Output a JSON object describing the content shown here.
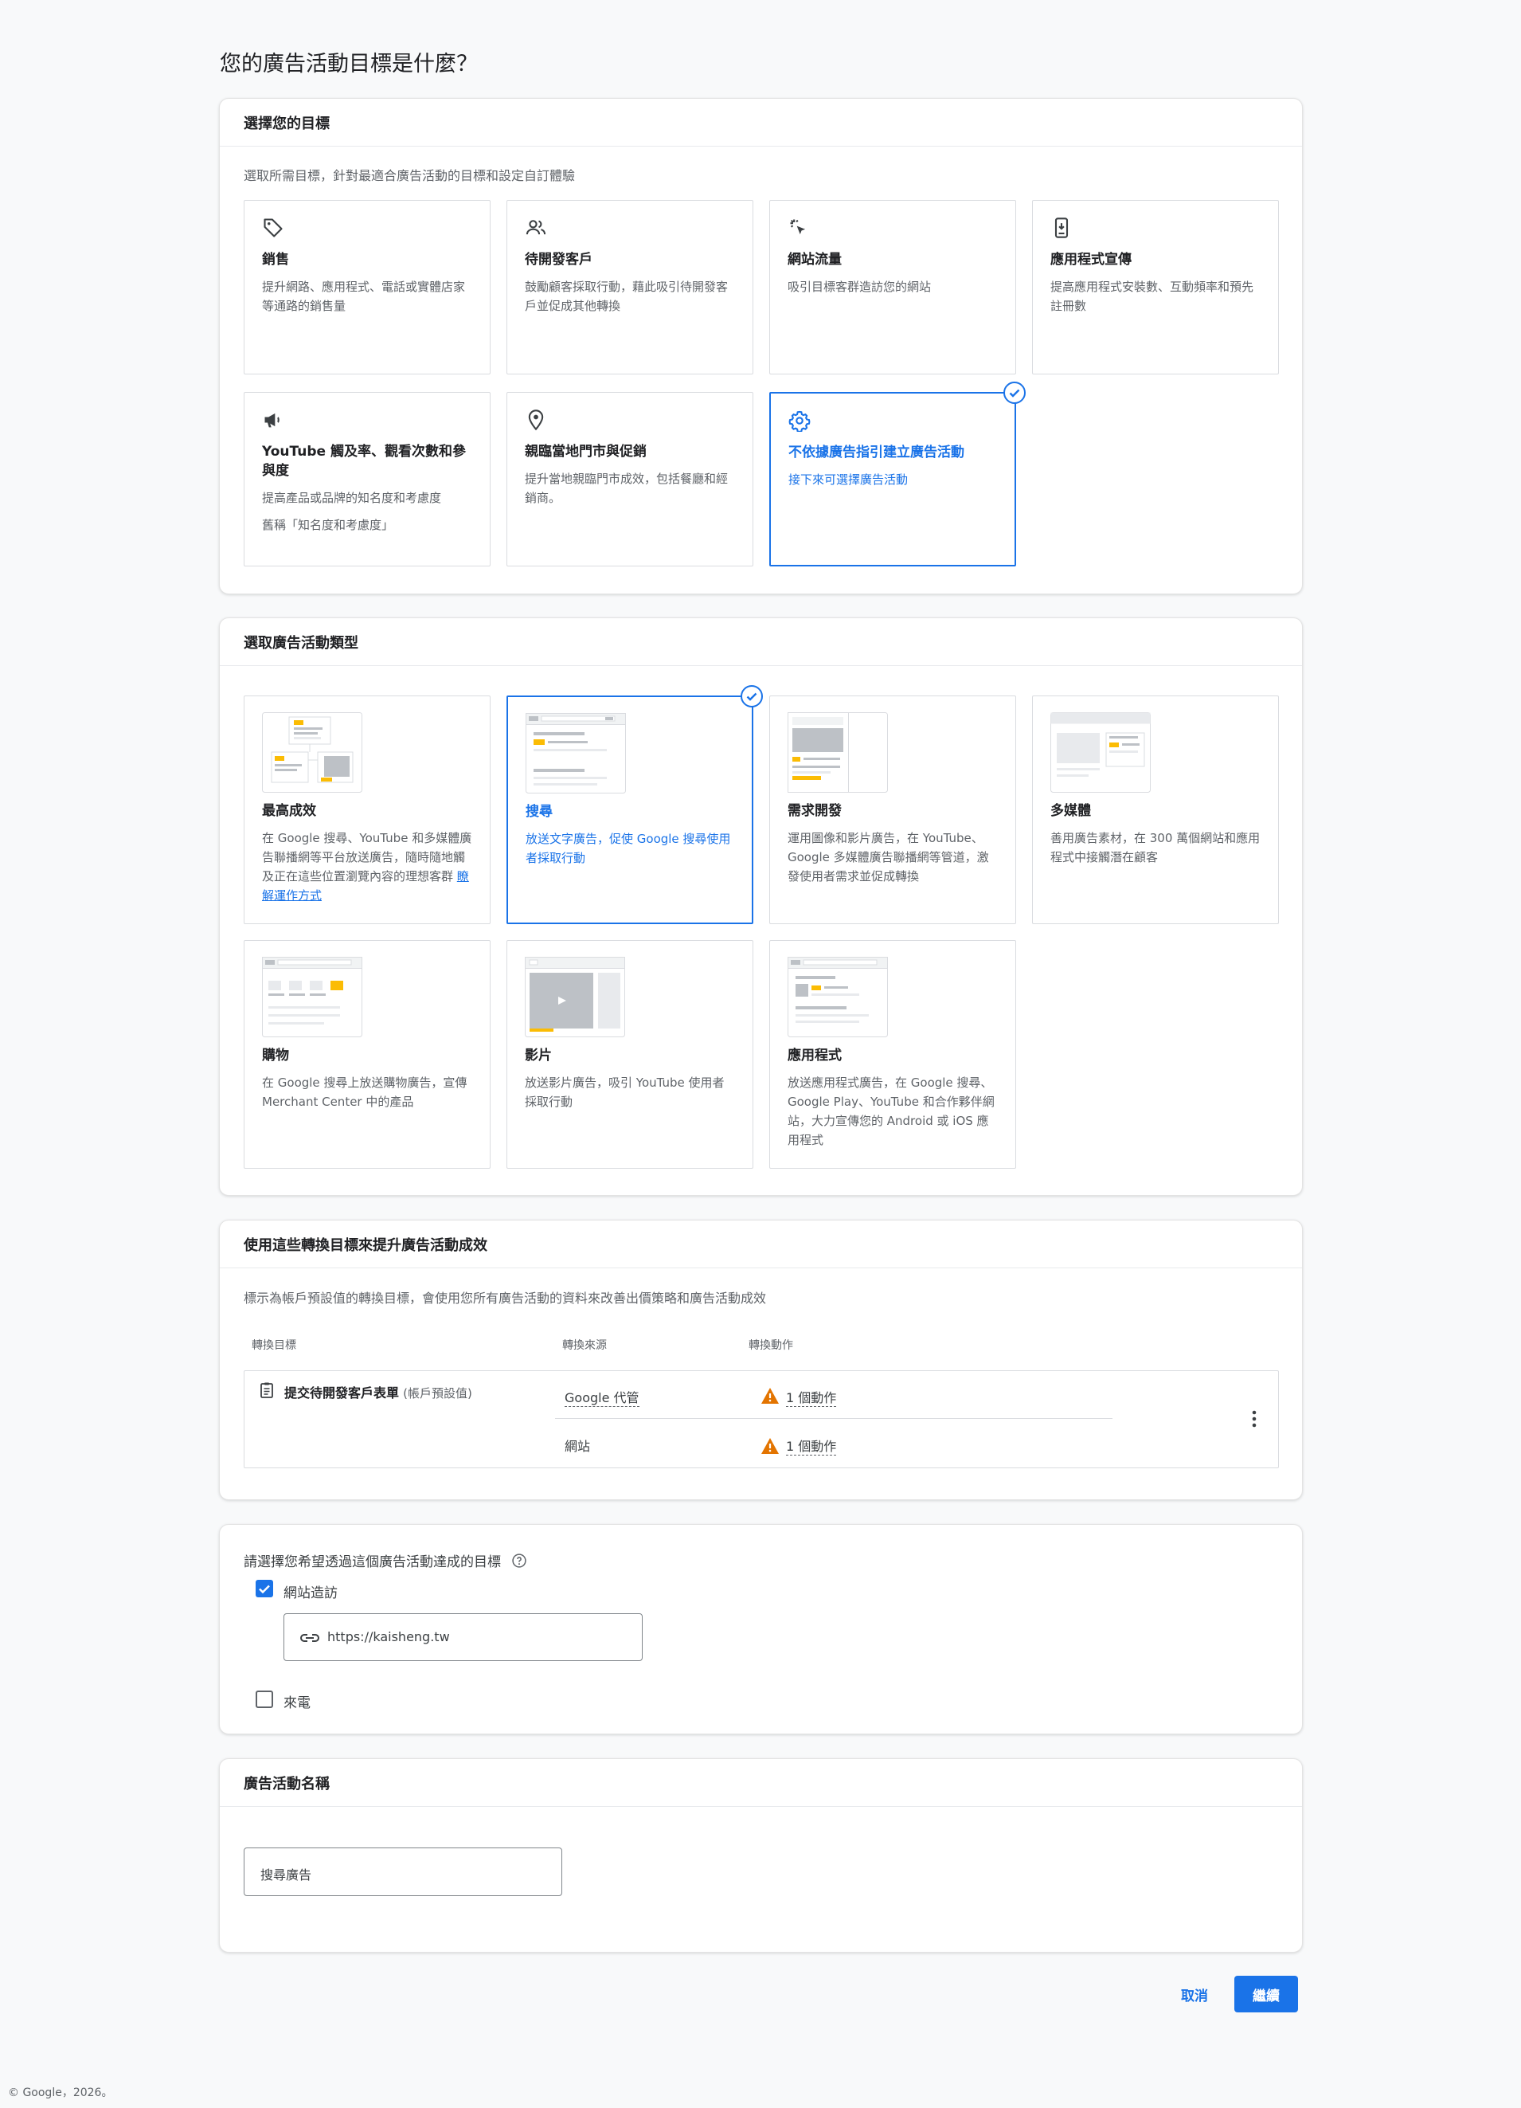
{
  "page": {
    "title": "您的廣告活動目標是什麼？"
  },
  "objective_section": {
    "header": "選擇您的目標",
    "description": "選取所需目標，針對最適合廣告活動的目標和設定自訂體驗",
    "tiles": [
      {
        "icon": "tag-icon",
        "title": "銷售",
        "desc": "提升網路、應用程式、電話或實體店家等通路的銷售量"
      },
      {
        "icon": "people-icon",
        "title": "待開發客戶",
        "desc": "鼓勵顧客採取行動，藉此吸引待開發客戶並促成其他轉換"
      },
      {
        "icon": "cursor-click-icon",
        "title": "網站流量",
        "desc": "吸引目標客群造訪您的網站"
      },
      {
        "icon": "phone-download-icon",
        "title": "應用程式宣傳",
        "desc": "提高應用程式安裝數、互動頻率和預先註冊數"
      },
      {
        "icon": "megaphone-icon",
        "title": "YouTube 觸及率、觀看次數和參與度",
        "desc": "提高產品或品牌的知名度和考慮度",
        "desc2": "舊稱「知名度和考慮度」"
      },
      {
        "icon": "location-pin-icon",
        "title": "親臨當地門市與促銷",
        "desc": "提升當地親臨門市成效，包括餐廳和經銷商。"
      },
      {
        "icon": "gear-icon",
        "title": "不依據廣告指引建立廣告活動",
        "desc": "接下來可選擇廣告活動",
        "selected": true
      }
    ]
  },
  "campaign_type_section": {
    "header": "選取廣告活動類型",
    "tiles": [
      {
        "thumb": "performance-max-thumbnail",
        "title": "最高成效",
        "desc": "在 Google 搜尋、YouTube 和多媒體廣告聯播網等平台放送廣告，隨時隨地觸及正在這些位置瀏覽內容的理想客群",
        "link": "瞭解運作方式"
      },
      {
        "thumb": "search-thumbnail",
        "title": "搜尋",
        "desc": "放送文字廣告，促使 Google 搜尋使用者採取行動",
        "selected": true
      },
      {
        "thumb": "demand-gen-thumbnail",
        "title": "需求開發",
        "desc": "運用圖像和影片廣告，在 YouTube、Google 多媒體廣告聯播網等管道，激發使用者需求並促成轉換"
      },
      {
        "thumb": "display-thumbnail",
        "title": "多媒體",
        "desc": "善用廣告素材，在 300 萬個網站和應用程式中接觸潛在顧客"
      },
      {
        "thumb": "shopping-thumbnail",
        "title": "購物",
        "desc": "在 Google 搜尋上放送購物廣告，宣傳 Merchant Center 中的產品"
      },
      {
        "thumb": "video-thumbnail",
        "title": "影片",
        "desc": "放送影片廣告，吸引 YouTube 使用者採取行動"
      },
      {
        "thumb": "app-thumbnail",
        "title": "應用程式",
        "desc": "放送應用程式廣告，在 Google 搜尋、Google Play、YouTube 和合作夥伴網站，大力宣傳您的 Android 或 iOS 應用程式"
      }
    ]
  },
  "conversion_section": {
    "header": "使用這些轉換目標來提升廣告活動成效",
    "description": "標示為帳戶預設值的轉換目標，會使用您所有廣告活動的資料來改善出價策略和廣告活動成效",
    "columns": [
      "轉換目標",
      "轉換來源",
      "轉換動作"
    ],
    "goal": {
      "name": "提交待開發客戶表單",
      "suffix": "(帳戶預設值)"
    },
    "rows": [
      {
        "source": "Google 代管",
        "action": "1 個動作"
      },
      {
        "source": "網站",
        "action": "1 個動作"
      }
    ]
  },
  "goal_select_section": {
    "question": "請選擇您希望透過這個廣告活動達成的目標",
    "options": [
      {
        "label": "網站造訪",
        "checked": true
      },
      {
        "label": "來電",
        "checked": false
      }
    ],
    "url_value": "https://kaisheng.tw"
  },
  "name_section": {
    "header": "廣告活動名稱",
    "value": "搜尋廣告"
  },
  "actions": {
    "cancel": "取消",
    "continue": "繼續"
  },
  "footer": {
    "text": "© Google，2026。"
  },
  "colors": {
    "accent": "#1a73e8",
    "warning": "#e37400",
    "yellow": "#fbbc04"
  }
}
